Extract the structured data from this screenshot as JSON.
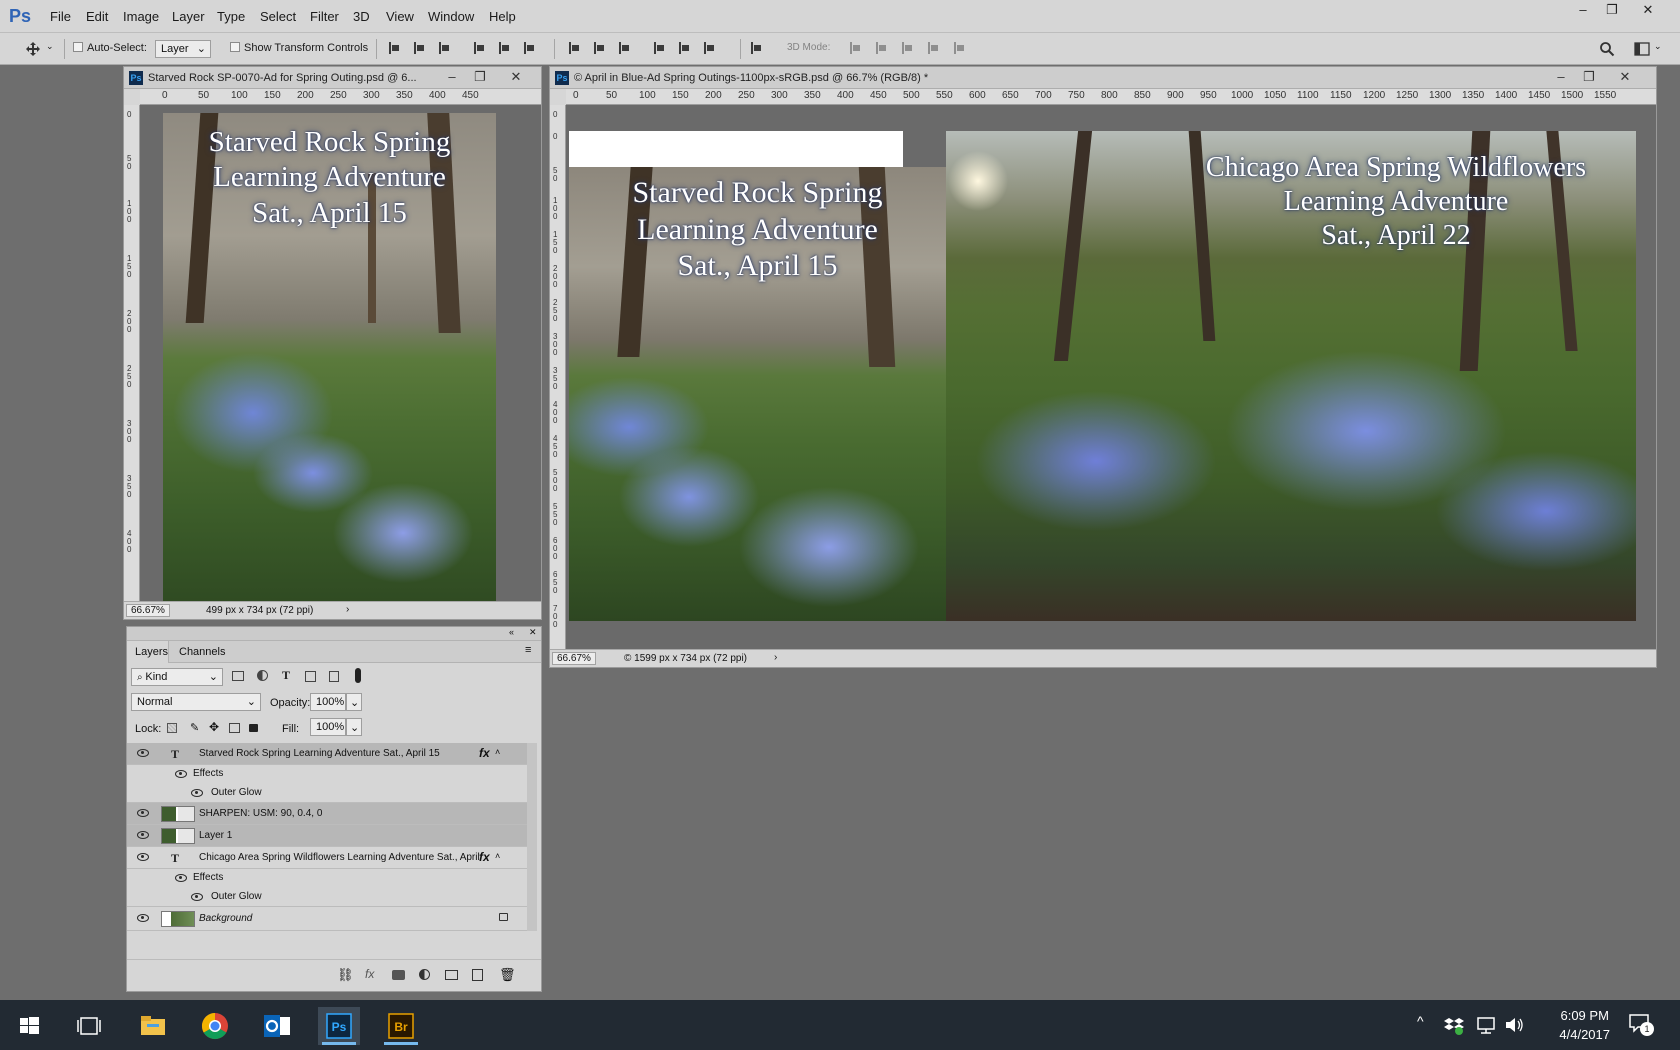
{
  "app": {
    "logo": "Ps"
  },
  "menu": [
    "File",
    "Edit",
    "Image",
    "Layer",
    "Type",
    "Select",
    "Filter",
    "3D",
    "View",
    "Window",
    "Help"
  ],
  "window_controls": {
    "minimize": "–",
    "maximize": "❐",
    "close": "✕"
  },
  "options_bar": {
    "auto_select_label": "Auto-Select:",
    "auto_select_value": "Layer",
    "show_transform_label": "Show Transform Controls",
    "mode_3d_label": "3D Mode:"
  },
  "doc_left": {
    "title": "Starved Rock SP-0070-Ad for Spring Outing.psd @ 6...",
    "ruler_h": [
      "0",
      "50",
      "100",
      "150",
      "200",
      "250",
      "300",
      "350",
      "400",
      "450"
    ],
    "ruler_v": [
      "0",
      "5 0",
      "1 0 0",
      "1 5 0",
      "2 0 0",
      "2 5 0",
      "3 0 0",
      "3 5 0",
      "4 0 0",
      "4 5 0"
    ],
    "zoom": "66.67%",
    "info": "499 px x 734 px (72 ppi)",
    "text_lines": [
      "Starved Rock Spring",
      "Learning Adventure",
      "Sat., April 15"
    ]
  },
  "doc_right": {
    "title": "© April in Blue-Ad Spring Outings-1100px-sRGB.psd @ 66.7% (RGB/8) *",
    "ruler_h": [
      "0",
      "50",
      "100",
      "150",
      "200",
      "250",
      "300",
      "350",
      "400",
      "450",
      "500",
      "550",
      "600",
      "650",
      "700",
      "750",
      "800",
      "850",
      "900",
      "950",
      "1000",
      "1050",
      "1100",
      "1150",
      "1200",
      "1250",
      "1300",
      "1350",
      "1400",
      "1450",
      "1500",
      "1550"
    ],
    "ruler_v": [
      "0",
      "0",
      "5 0",
      "1 0 0",
      "1 5 0",
      "2 0 0",
      "2 5 0",
      "3 0 0",
      "3 5 0",
      "4 0 0",
      "4 5 0",
      "5 0 0",
      "5 5 0",
      "6 0 0",
      "6 5 0",
      "7 0 0",
      "7 5 0"
    ],
    "zoom": "66.67%",
    "info": "© 1599 px x 734 px (72 ppi)",
    "left_text": [
      "Starved Rock Spring",
      "Learning Adventure",
      "Sat., April 15"
    ],
    "right_text": [
      "Chicago Area Spring Wildflowers",
      "Learning Adventure",
      "Sat., April 22"
    ]
  },
  "layers_panel": {
    "tabs": [
      "Layers",
      "Channels"
    ],
    "filter_kind": "Kind",
    "blend_mode": "Normal",
    "opacity_label": "Opacity:",
    "opacity_value": "100%",
    "lock_label": "Lock:",
    "fill_label": "Fill:",
    "fill_value": "100%",
    "layers": [
      {
        "name": "Starved Rock Spring Learning Adventure Sat., April 15",
        "type": "text"
      },
      {
        "name": "Effects",
        "type": "effects"
      },
      {
        "name": "Outer Glow",
        "type": "effect"
      },
      {
        "name": "SHARPEN: USM: 90, 0.4, 0",
        "type": "pixel"
      },
      {
        "name": "Layer 1",
        "type": "pixel"
      },
      {
        "name": "Chicago Area Spring Wildflowers Learning Adventure Sat., April",
        "type": "text"
      },
      {
        "name": "Effects",
        "type": "effects"
      },
      {
        "name": "Outer Glow",
        "type": "effect"
      },
      {
        "name": "Background",
        "type": "background"
      }
    ],
    "fx_label": "fx"
  },
  "taskbar": {
    "apps": [
      "start-icon",
      "task-view-icon",
      "file-explorer-icon",
      "chrome-icon",
      "outlook-icon",
      "photoshop-icon",
      "bridge-icon"
    ],
    "time": "6:09 PM",
    "date": "4/4/2017",
    "notification_count": "1"
  }
}
